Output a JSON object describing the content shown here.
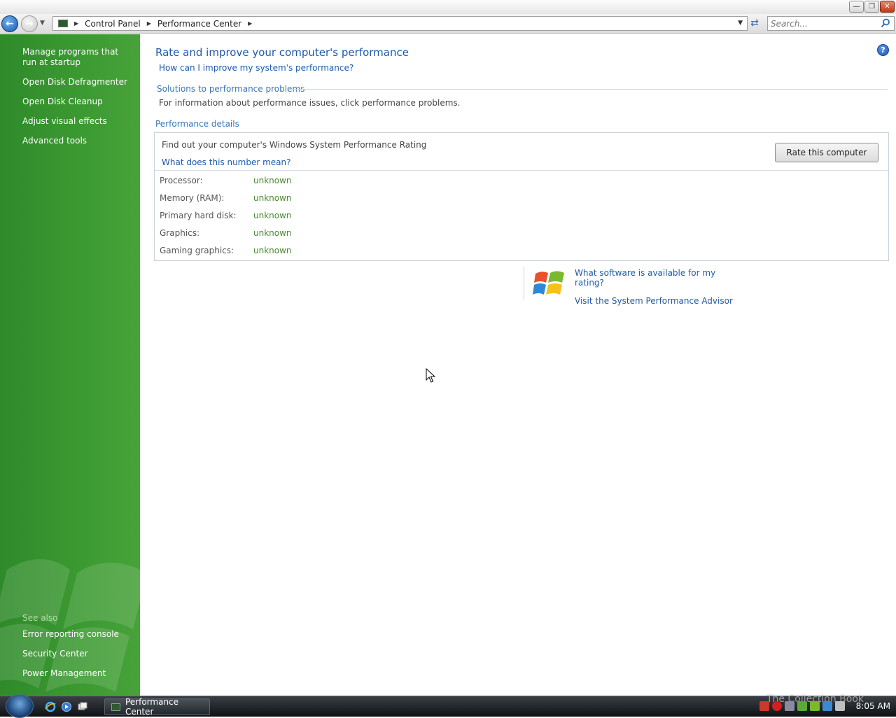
{
  "window": {
    "caption_buttons": [
      "minimize-icon",
      "maximize-icon",
      "close-icon"
    ]
  },
  "navbar": {
    "breadcrumbs": [
      "Control Panel",
      "Performance Center"
    ],
    "search_placeholder": "Search..."
  },
  "sidebar": {
    "tasks": [
      {
        "label": "Manage programs that run at startup"
      },
      {
        "label": "Open Disk Defragmenter"
      },
      {
        "label": "Open Disk Cleanup"
      },
      {
        "label": "Adjust visual effects"
      },
      {
        "label": "Advanced tools"
      }
    ],
    "see_also_label": "See also",
    "see_also": [
      {
        "label": "Error reporting console"
      },
      {
        "label": "Security Center"
      },
      {
        "label": "Power Management"
      }
    ]
  },
  "main": {
    "title": "Rate and improve your computer's performance",
    "improve_link": "How can I improve my system's performance?",
    "solutions_heading": "Solutions to performance problems",
    "solutions_text": "For information about performance issues, click performance problems.",
    "details_heading": "Performance details",
    "rating_prompt": "Find out your computer's Windows System Performance Rating",
    "what_number_link": "What does this number mean?",
    "rate_button": "Rate this computer",
    "rows": [
      {
        "label": "Processor:",
        "value": "unknown"
      },
      {
        "label": "Memory (RAM):",
        "value": "unknown"
      },
      {
        "label": "Primary hard disk:",
        "value": "unknown"
      },
      {
        "label": "Graphics:",
        "value": "unknown"
      },
      {
        "label": "Gaming graphics:",
        "value": "unknown"
      }
    ],
    "software_link": "What software is available for my rating?",
    "advisor_link": "Visit the System Performance Advisor"
  },
  "taskbar": {
    "active_window": "Performance Center",
    "clock": "8:05 AM",
    "watermark": "The Collection Book"
  },
  "colors": {
    "sidebar_green": "#3c9a32",
    "link_blue": "#1e5aa8",
    "value_green": "#4a8a32"
  }
}
